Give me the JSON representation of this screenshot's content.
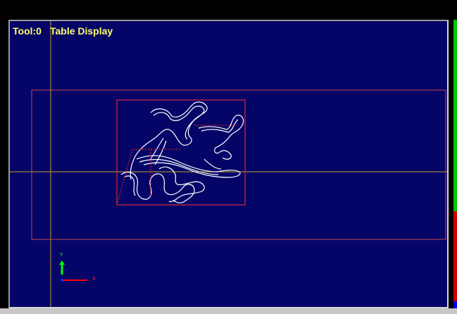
{
  "title": {
    "tool_label": "Tool:0",
    "display_name": "Table Display"
  },
  "colors": {
    "background": "#050568",
    "crosshair": "#c8a020",
    "table_outline": "#c84848",
    "part_outline": "#ff3030",
    "path": "#ffffff",
    "path_rapid": "#ff2020",
    "axis_y": "#00ff00",
    "axis_x": "#ff0000",
    "axis_z": "#2020ff",
    "edge_green": "#00c800",
    "edge_red": "#d10000"
  },
  "axes": {
    "y_label": "Y",
    "x_label": "X"
  }
}
